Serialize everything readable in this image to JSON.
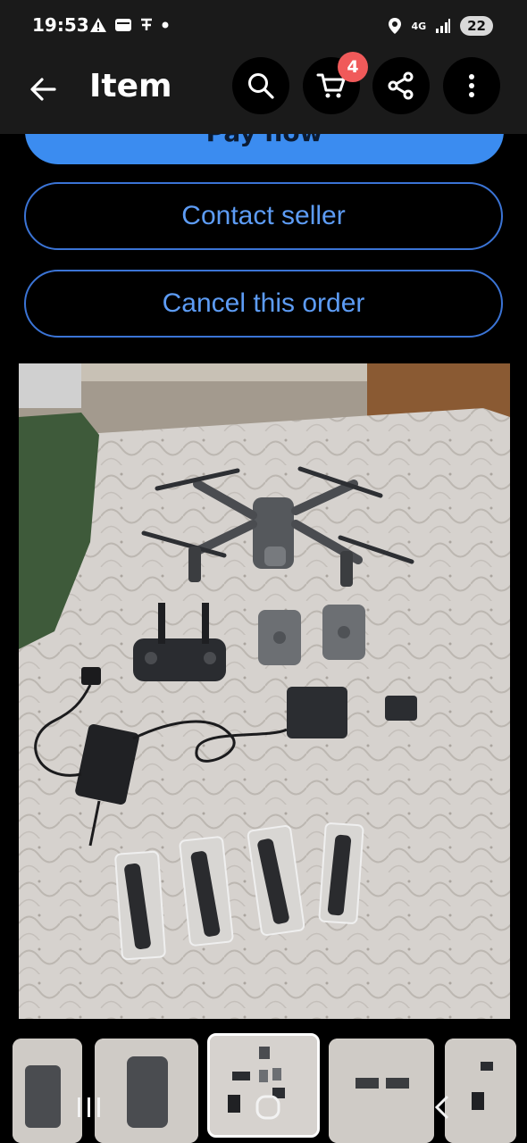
{
  "status_bar": {
    "time": "19:53",
    "network": "4G",
    "battery": "22"
  },
  "app_bar": {
    "title": "Item",
    "cart_count": "4"
  },
  "actions": {
    "pay_now": "Pay now",
    "contact_seller": "Contact seller",
    "cancel_order": "Cancel this order"
  },
  "photo": {
    "alt": "Drone kit laid out on bed"
  },
  "colors": {
    "accent": "#3b8cf0",
    "link": "#5d9cf5",
    "badge": "#f05a5a"
  }
}
